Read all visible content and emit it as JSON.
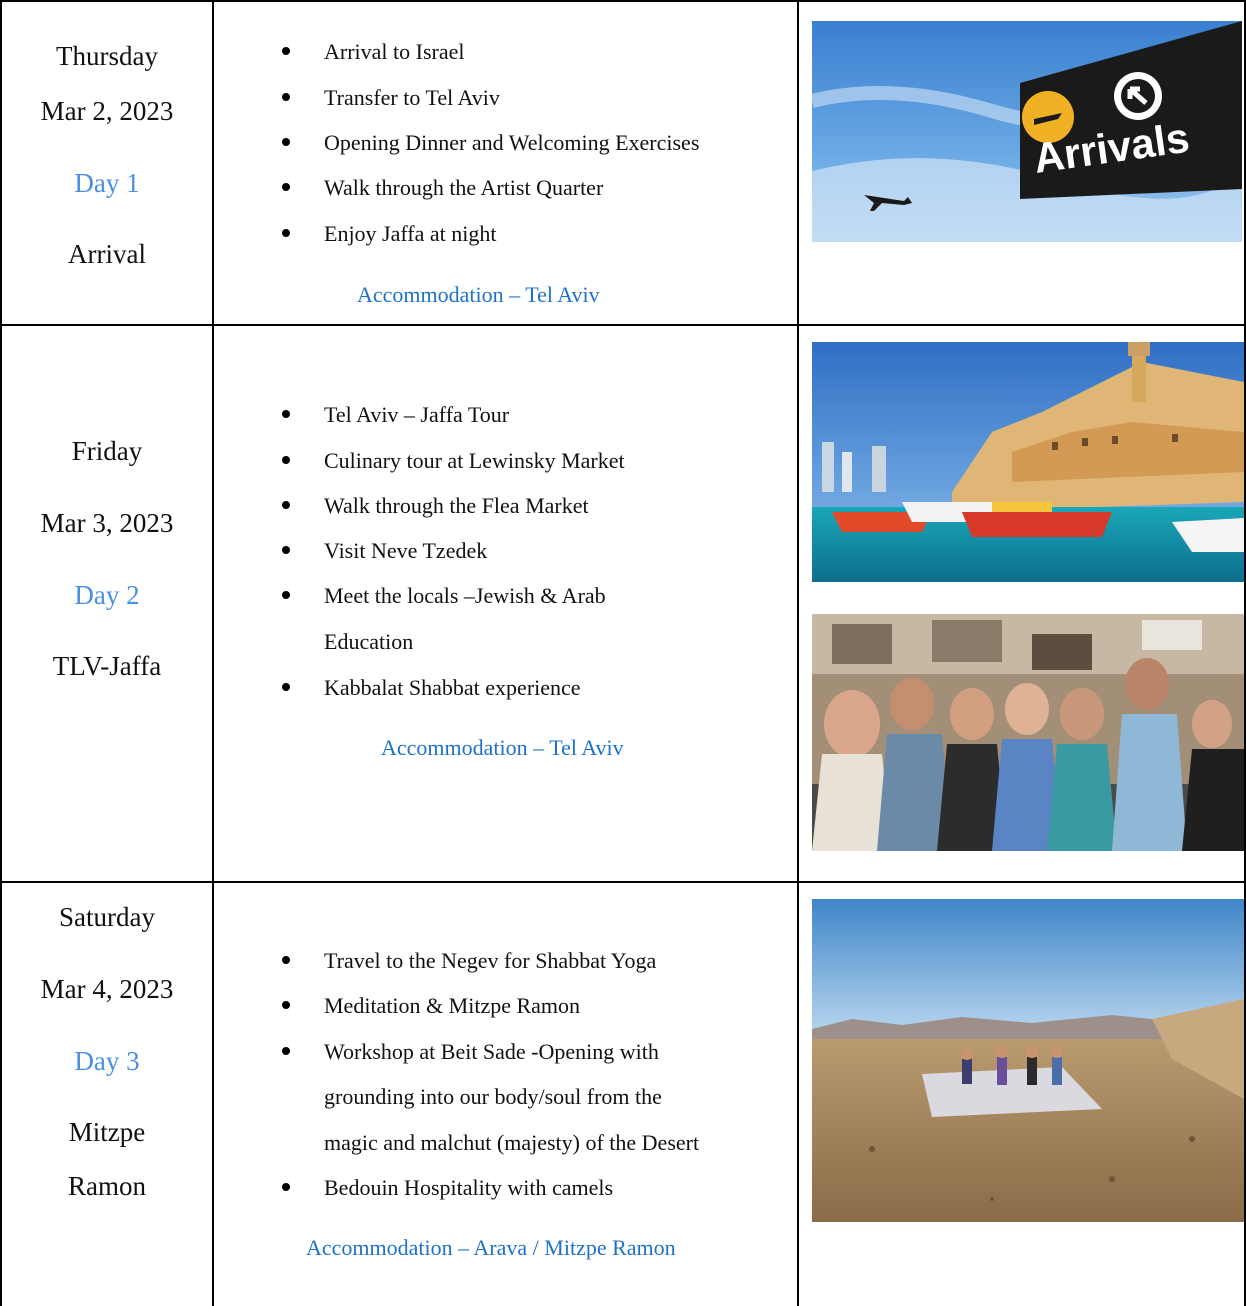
{
  "days": [
    {
      "weekday": "Thursday",
      "date": "Mar 2, 2023",
      "day_label": "Day 1",
      "place": [
        "Arrival"
      ],
      "items": [
        "Arrival to Israel",
        "Transfer to Tel Aviv",
        "Opening Dinner and Welcoming Exercises",
        "Walk through the Artist Quarter",
        "Enjoy Jaffa at night"
      ],
      "accommodation": "Accommodation – Tel Aviv",
      "photo_sign_text": "Arrivals"
    },
    {
      "weekday": "Friday",
      "date": "Mar 3, 2023",
      "day_label": "Day 2",
      "place": [
        "TLV-Jaffa"
      ],
      "items": [
        "Tel Aviv – Jaffa Tour",
        "Culinary tour at Lewinsky Market",
        "Walk through the Flea Market",
        "Visit Neve Tzedek",
        "Meet the locals –Jewish & Arab",
        "Education",
        "Kabbalat Shabbat experience"
      ],
      "accommodation": "Accommodation – Tel Aviv"
    },
    {
      "weekday": "Saturday",
      "date": "Mar 4, 2023",
      "day_label": "Day 3",
      "place": [
        "Mitzpe",
        "Ramon"
      ],
      "items": [
        "Travel to the Negev for Shabbat Yoga",
        "Meditation & Mitzpe Ramon",
        "Workshop at Beit Sade -Opening with",
        "grounding into our body/soul from the",
        "magic and malchut (majesty) of the Desert",
        "Bedouin Hospitality with camels"
      ],
      "accommodation": "Accommodation – Arava / Mitzpe Ramon"
    }
  ],
  "colors": {
    "day_label": "#4a90e2",
    "accommodation": "#1e72c7",
    "grid": "#000000"
  }
}
